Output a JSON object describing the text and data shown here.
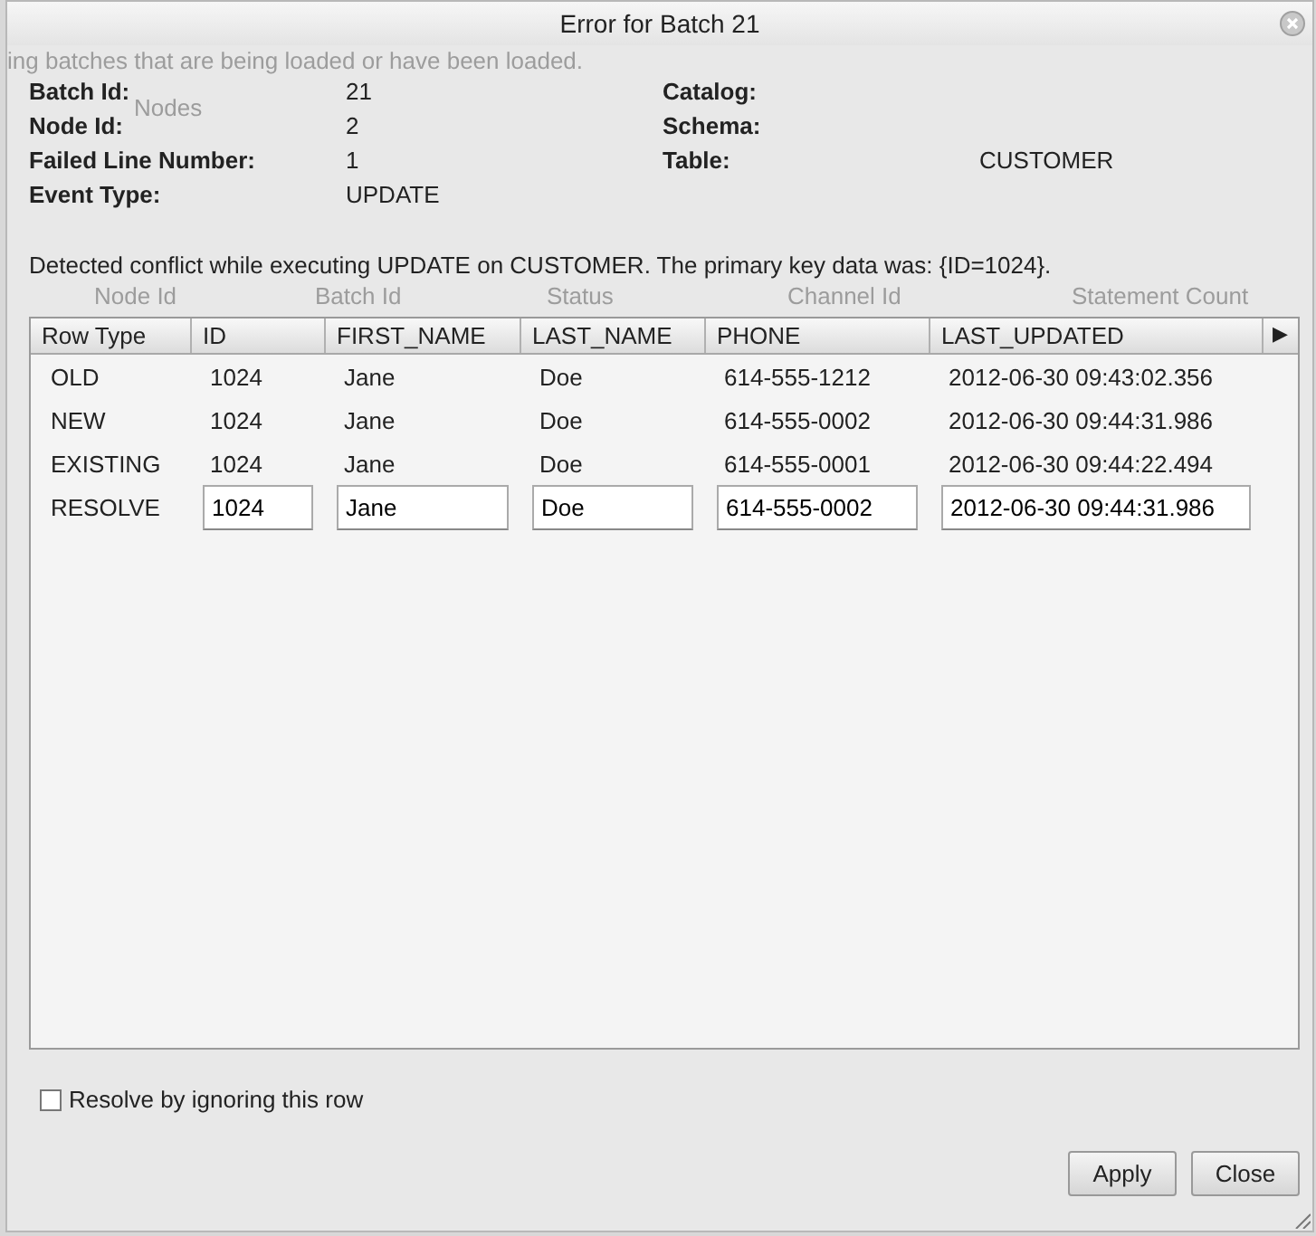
{
  "background": {
    "sentence": "ing batches that are being loaded or have been loaded.",
    "tab": "Nodes",
    "columns": [
      "Node Id",
      "Batch Id",
      "Status",
      "Channel Id",
      "Statement Count"
    ]
  },
  "dialog": {
    "title": "Error for Batch 21"
  },
  "details_left": [
    {
      "label": "Batch Id:",
      "value": "21"
    },
    {
      "label": "Node Id:",
      "value": "2"
    },
    {
      "label": "Failed Line Number:",
      "value": "1"
    },
    {
      "label": "Event Type:",
      "value": "UPDATE"
    }
  ],
  "details_right": [
    {
      "label": "Catalog:"
    },
    {
      "label": "Schema:"
    },
    {
      "label": "Table:",
      "value": "CUSTOMER"
    }
  ],
  "message": "Detected conflict while executing UPDATE on CUSTOMER. The primary key data was: {ID=1024}.",
  "table": {
    "columns": [
      "Row Type",
      "ID",
      "FIRST_NAME",
      "LAST_NAME",
      "PHONE",
      "LAST_UPDATED"
    ],
    "scroll_arrow": "▶",
    "rows": [
      {
        "kind": "text",
        "cells": [
          "OLD",
          "1024",
          "Jane",
          "Doe",
          "614-555-1212",
          "2012-06-30 09:43:02.356"
        ]
      },
      {
        "kind": "text",
        "cells": [
          "NEW",
          "1024",
          "Jane",
          "Doe",
          "614-555-0002",
          "2012-06-30 09:44:31.986"
        ]
      },
      {
        "kind": "text",
        "cells": [
          "EXISTING",
          "1024",
          "Jane",
          "Doe",
          "614-555-0001",
          "2012-06-30 09:44:22.494"
        ]
      },
      {
        "kind": "edit",
        "cells": [
          "RESOLVE",
          "1024",
          "Jane",
          "Doe",
          "614-555-0002",
          "2012-06-30 09:44:31.986"
        ]
      }
    ]
  },
  "ignore_option": {
    "label": "Resolve by ignoring this row",
    "checked": false
  },
  "buttons": [
    "Apply",
    "Close"
  ]
}
